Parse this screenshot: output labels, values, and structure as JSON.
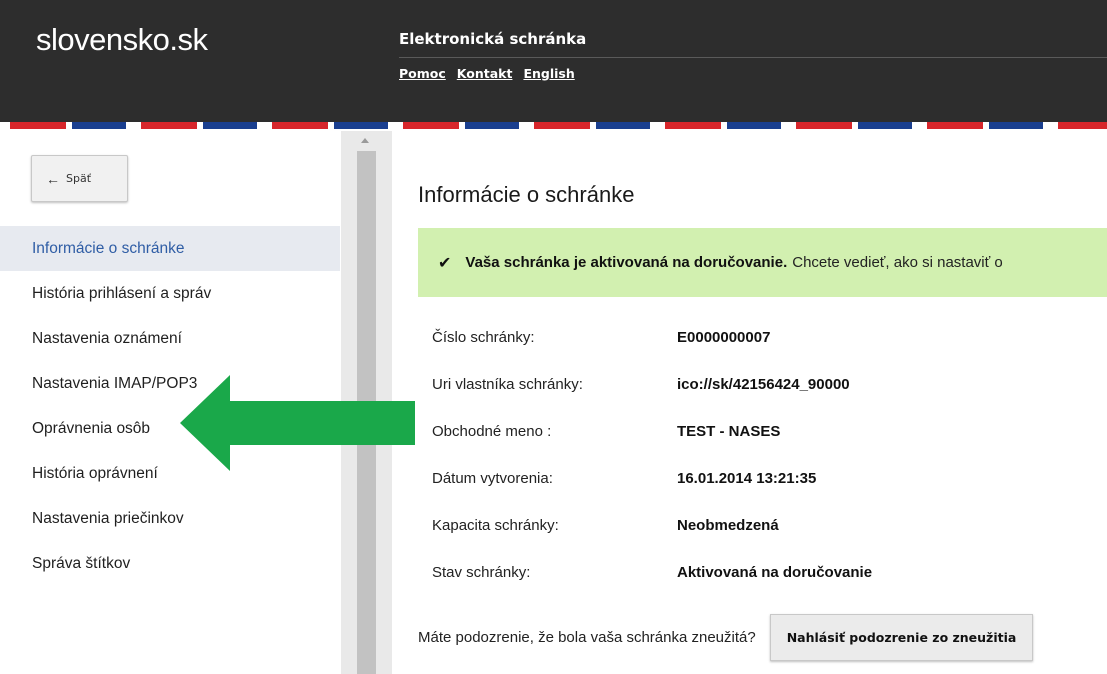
{
  "header": {
    "logo": "slovensko.sk",
    "app_title": "Elektronická schránka",
    "links": [
      "Pomoc",
      "Kontakt",
      "English"
    ]
  },
  "sidebar": {
    "back_label": "Späť",
    "items": [
      {
        "label": "Informácie o schránke",
        "active": true
      },
      {
        "label": "História prihlásení a správ",
        "active": false
      },
      {
        "label": "Nastavenia oznámení",
        "active": false
      },
      {
        "label": "Nastavenia IMAP/POP3",
        "active": false
      },
      {
        "label": "Oprávnenia osôb",
        "active": false
      },
      {
        "label": "História oprávnení",
        "active": false
      },
      {
        "label": "Nastavenia priečinkov",
        "active": false
      },
      {
        "label": "Správa štítkov",
        "active": false
      }
    ]
  },
  "main": {
    "title": "Informácie o schránke",
    "alert": {
      "icon": "check-icon",
      "strong": "Vaša schránka je aktivovaná na doručovanie.",
      "text": "Chcete vedieť, ako si nastaviť o"
    },
    "info": [
      {
        "label": "Číslo schránky:",
        "value": "E0000000007"
      },
      {
        "label": "Uri vlastníka schránky:",
        "value": "ico://sk/42156424_90000"
      },
      {
        "label": "Obchodné meno :",
        "value": "TEST - NASES"
      },
      {
        "label": "Dátum vytvorenia:",
        "value": "16.01.2014 13:21:35"
      },
      {
        "label": "Kapacita schránky:",
        "value": "Neobmedzená"
      },
      {
        "label": "Stav schránky:",
        "value": "Aktivovaná na doručovanie"
      }
    ],
    "report_question": "Máte podozrenie, že bola vaša schránka zneužitá?",
    "report_button": "Nahlásiť podozrenie zo zneužitia"
  },
  "colors": {
    "header_bg": "#2d2d2d",
    "active_link": "#2f5da5",
    "alert_bg": "#d2f0b0",
    "annotation_arrow": "#1aa84a",
    "stripe_red": "#d7262b",
    "stripe_blue": "#1a3f8f"
  }
}
